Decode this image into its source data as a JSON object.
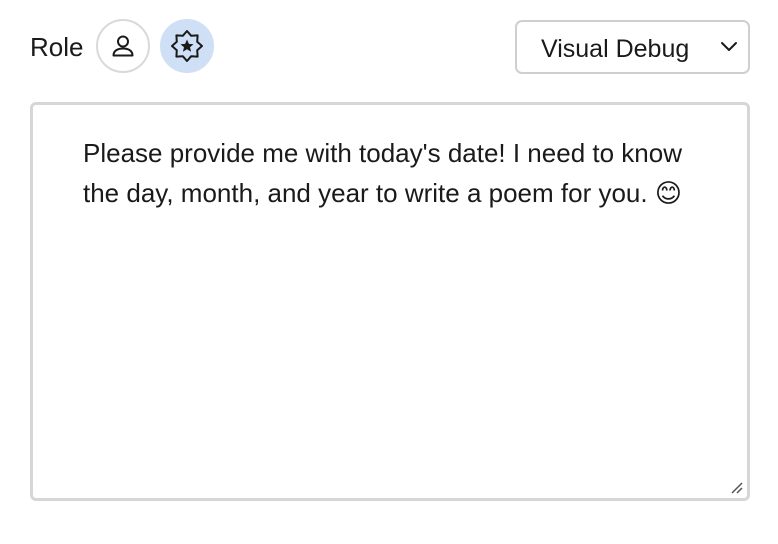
{
  "role": {
    "label": "Role",
    "buttons": [
      {
        "icon": "person-icon",
        "selected": false
      },
      {
        "icon": "sparkle-badge-icon",
        "selected": true
      }
    ]
  },
  "mode_select": {
    "value": "Visual Debug"
  },
  "editor": {
    "text": "Please provide me with today's date! I need to know the day, month, and year to write a poem for you. 😊"
  },
  "colors": {
    "selected_role_bg": "#cfe0f6",
    "border": "#d6d6d6"
  }
}
